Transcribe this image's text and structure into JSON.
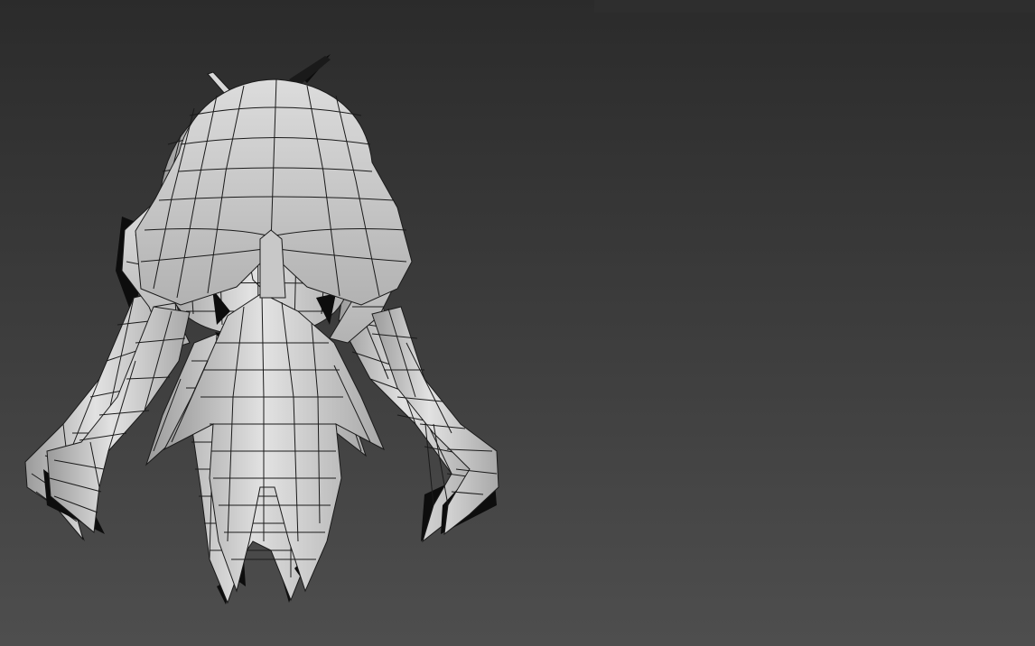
{
  "viewport": {
    "background_top": "#2b2b2b",
    "background_bottom": "#4e4e4e",
    "mesh_fill": "#c4c4c4",
    "mesh_fill_light": "#e0e0e0",
    "wire_color": "#1a1a1a",
    "shadow_color": "#0d0d0d"
  },
  "models": [
    {
      "view": "front"
    },
    {
      "view": "back"
    }
  ]
}
